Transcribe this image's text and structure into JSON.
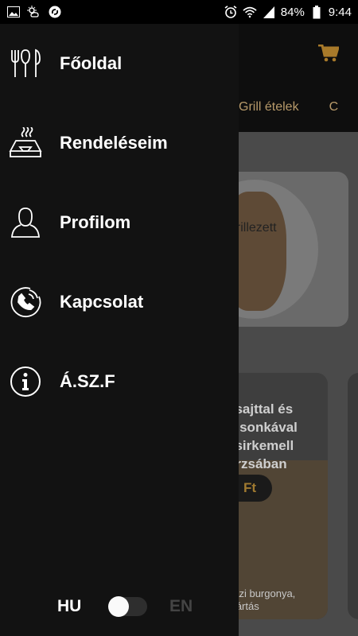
{
  "status_bar": {
    "left_icons": [
      "image-icon",
      "weather-icon",
      "sync-icon"
    ],
    "right_icons": [
      "alarm-icon",
      "wifi-icon",
      "signal-icon",
      "battery-icon"
    ],
    "battery": "84%",
    "time": "9:44"
  },
  "drawer": {
    "items": [
      {
        "label": "Főoldal",
        "icon": "cutlery-icon"
      },
      {
        "label": "Rendeléseim",
        "icon": "food-tray-icon"
      },
      {
        "label": "Profilom",
        "icon": "user-icon"
      },
      {
        "label": "Kapcsolat",
        "icon": "phone-icon"
      },
      {
        "label": "Á.SZ.F",
        "icon": "info-icon"
      }
    ],
    "language": {
      "left": "HU",
      "right": "EN",
      "selected": "HU"
    }
  },
  "background": {
    "tabs": [
      "Grill ételek",
      "C"
    ],
    "card1_text": "grillezett",
    "card2_title": [
      "esajttal és",
      "o sonkával",
      "csirkemell",
      "orzsában"
    ],
    "card2_price": "Ft",
    "card2_sub": [
      "házi burgonya,",
      "mártás"
    ]
  },
  "colors": {
    "accent": "#a87a2a",
    "drawer_bg": "#121212",
    "content_dim": "#4a4a4a"
  }
}
